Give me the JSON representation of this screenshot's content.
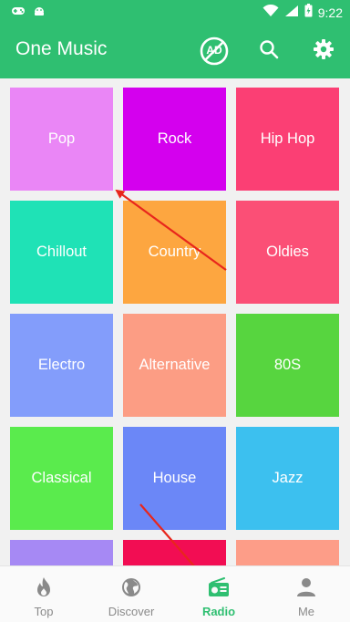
{
  "status_bar": {
    "time": "9:22",
    "left_icons": [
      "gamepad-icon",
      "android-icon"
    ],
    "right_icons": [
      "wifi-icon",
      "signal-icon",
      "battery-icon"
    ]
  },
  "app_bar": {
    "title": "One Music",
    "ad_label": "AD",
    "actions": [
      "no-ads-icon",
      "search-icon",
      "settings-icon"
    ]
  },
  "genres": [
    {
      "label": "Pop",
      "color": "#ea86f6"
    },
    {
      "label": "Rock",
      "color": "#d400ee"
    },
    {
      "label": "Hip Hop",
      "color": "#fb3f74"
    },
    {
      "label": "Chillout",
      "color": "#1fe2b6"
    },
    {
      "label": "Country",
      "color": "#fda640"
    },
    {
      "label": "Oldies",
      "color": "#fb4f76"
    },
    {
      "label": "Electro",
      "color": "#839dfb"
    },
    {
      "label": "Alternative",
      "color": "#fc9d84"
    },
    {
      "label": "80S",
      "color": "#57d53f"
    },
    {
      "label": "Classical",
      "color": "#5aeb4d"
    },
    {
      "label": "House",
      "color": "#6b87f7"
    },
    {
      "label": "Jazz",
      "color": "#3cc0ef"
    },
    {
      "label": "",
      "color": "#a689f4"
    },
    {
      "label": "",
      "color": "#f20d53"
    },
    {
      "label": "",
      "color": "#fd9d88"
    }
  ],
  "bottom_nav": {
    "items": [
      {
        "label": "Top",
        "icon": "fire-icon",
        "active": false
      },
      {
        "label": "Discover",
        "icon": "globe-icon",
        "active": false
      },
      {
        "label": "Radio",
        "icon": "radio-icon",
        "active": true
      },
      {
        "label": "Me",
        "icon": "person-icon",
        "active": false
      }
    ]
  },
  "colors": {
    "primary": "#2fbf71",
    "annotation": "#e8261c"
  }
}
